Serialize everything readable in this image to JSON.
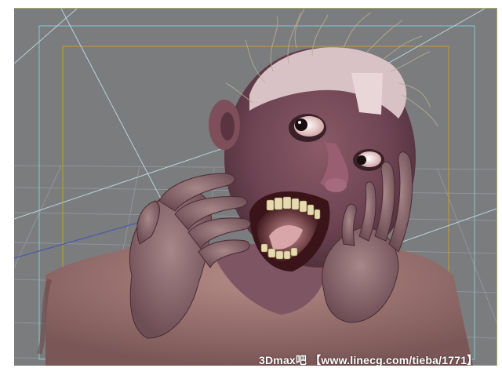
{
  "viewport": {
    "background_color": "#7b7c7d",
    "safe_frame_outer_color": "#7ecad6",
    "safe_frame_inner_color": "#c79a32",
    "grid_color": "#9aa0a4",
    "subject": "screaming zombie character model"
  },
  "watermark": {
    "text": "3Dmax吧 【www.linecg.com/tieba/1771】"
  }
}
